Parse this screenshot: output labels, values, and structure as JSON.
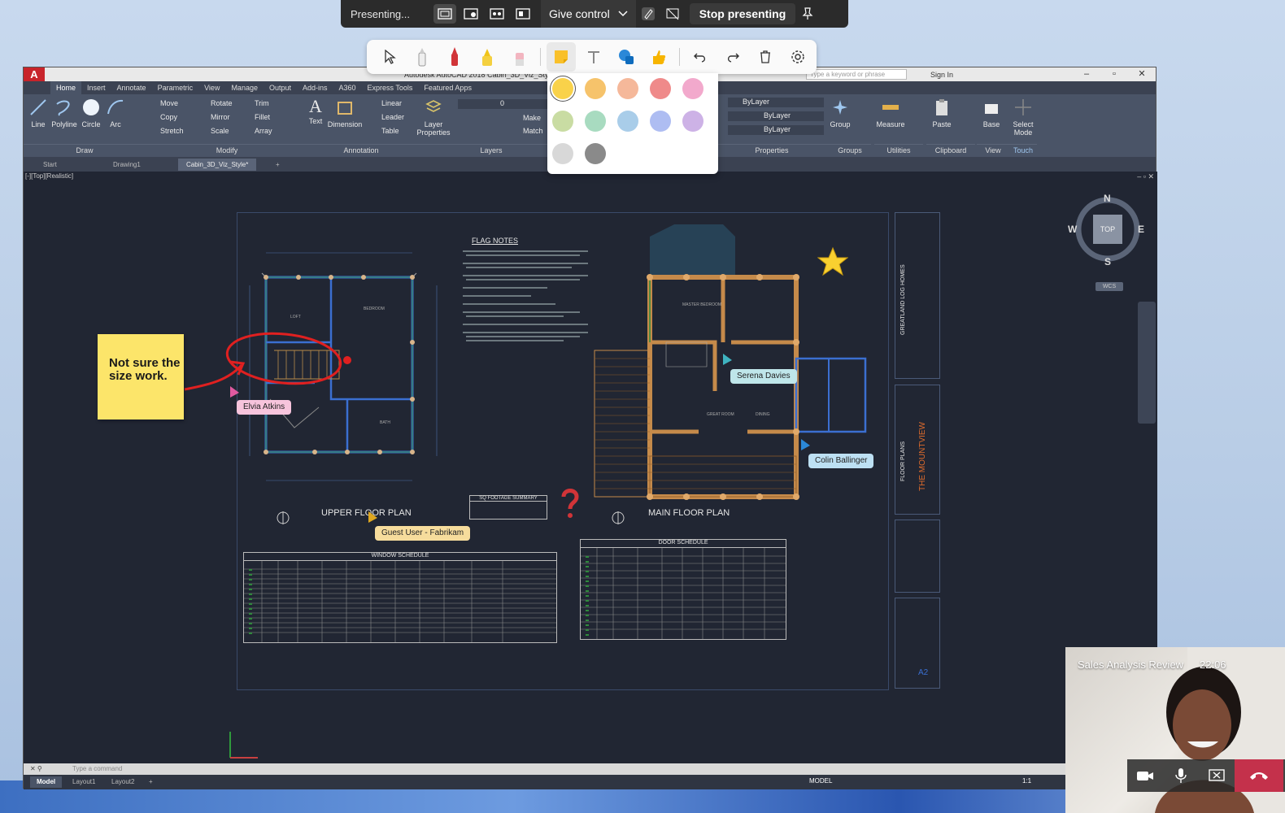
{
  "presenting_bar": {
    "status": "Presenting...",
    "give_control": "Give control",
    "stop": "Stop presenting"
  },
  "ink_toolbar": {
    "tools": [
      "pointer-icon",
      "pen-icon",
      "red-pen-icon",
      "highlighter-icon",
      "eraser-icon",
      "sticky-note-icon",
      "text-icon",
      "shapes-icon",
      "reaction-icon",
      "undo-icon",
      "redo-icon",
      "delete-icon",
      "settings-icon"
    ],
    "palette": [
      "#f9d24a",
      "#f6c36b",
      "#f5b89a",
      "#ef8a8a",
      "#f2a9cc",
      "#c9dca3",
      "#a8dbc0",
      "#a9cde9",
      "#aebdf2",
      "#cdb2e6",
      "#d8d8d8",
      "#8a8a8a"
    ],
    "selected_color": "#f9d24a"
  },
  "autocad": {
    "logo": "A",
    "title": "Autodesk AutoCAD 2018  Cabin_3D_Viz_Style...",
    "search_placeholder": "Type a keyword or phrase",
    "sign_in": "Sign In",
    "ribbon_tabs": [
      "Home",
      "Insert",
      "Annotate",
      "Parametric",
      "View",
      "Manage",
      "Output",
      "Add-ins",
      "A360",
      "Express Tools",
      "Featured Apps"
    ],
    "draw": {
      "line": "Line",
      "polyline": "Polyline",
      "circle": "Circle",
      "arc": "Arc",
      "panel": "Draw"
    },
    "modify": {
      "move": "Move",
      "rotate": "Rotate",
      "trim": "Trim",
      "copy": "Copy",
      "mirror": "Mirror",
      "fillet": "Fillet",
      "stretch": "Stretch",
      "scale": "Scale",
      "array": "Array",
      "panel": "Modify"
    },
    "annotation": {
      "text": "Text",
      "dimension": "Dimension",
      "linear": "Linear",
      "leader": "Leader",
      "table": "Table",
      "panel": "Annotation"
    },
    "layers": {
      "layer_properties": "Layer Properties",
      "make": "Make",
      "match": "Match",
      "panel": "Layers",
      "layer_value": "0"
    },
    "properties": {
      "bylayer1": "ByLayer",
      "bylayer2": "ByLayer",
      "bylayer3": "ByLayer",
      "panel": "Properties"
    },
    "groups": {
      "group": "Group",
      "panel": "Groups"
    },
    "utilities": {
      "measure": "Measure",
      "panel": "Utilities"
    },
    "clipboard": {
      "paste": "Paste",
      "panel": "Clipboard"
    },
    "view": {
      "base": "Base",
      "panel": "View"
    },
    "touch": {
      "select_mode": "Select Mode",
      "panel": "Touch"
    },
    "doc_tabs": [
      "Start",
      "Drawing1",
      "Cabin_3D_Viz_Style*"
    ],
    "viewport_label": "[-][Top][Realistic]",
    "viewcube": {
      "n": "N",
      "s": "S",
      "e": "E",
      "w": "W",
      "top": "TOP",
      "wcs": "WCS"
    },
    "command_placeholder": "Type a command",
    "layout_tabs": [
      "Model",
      "Layout1",
      "Layout2"
    ],
    "status_model": "MODEL",
    "status_scale": "1:1"
  },
  "drawing": {
    "flag_notes": "FLAG NOTES",
    "upper_floor_plan": "UPPER FLOOR PLAN",
    "main_floor_plan": "MAIN FLOOR PLAN",
    "window_schedule": "WINDOW SCHEDULE",
    "door_schedule": "DOOR SCHEDULE",
    "sq_footage": "SQ FOOTAGE SUMMARY",
    "tb_company": "GREATLAND LOG HOMES",
    "tb_project": "THE MOUNTVIEW",
    "tb_sheet": "FLOOR PLANS",
    "tb_number": "A2"
  },
  "annotations": {
    "sticky_note": "Not sure the size work.",
    "cursors": [
      {
        "name": "Elvia Atkins",
        "color": "#f7c4dc"
      },
      {
        "name": "Serena Davies",
        "color": "#bfe6ea"
      },
      {
        "name": "Colin Ballinger",
        "color": "#bde0f3"
      },
      {
        "name": "Guest User - Fabrikam",
        "color": "#f6dc9c"
      }
    ]
  },
  "video": {
    "meeting_title": "Sales Analysis Review",
    "time": "22:06"
  }
}
